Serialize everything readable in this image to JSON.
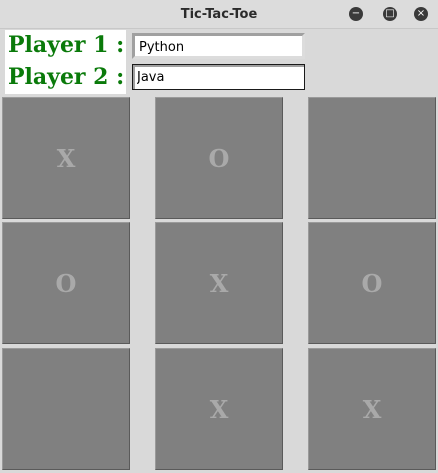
{
  "window": {
    "title": "Tic-Tac-Toe",
    "controls": {
      "minimize_glyph": "−",
      "maximize_glyph": "□",
      "close_glyph": "×"
    }
  },
  "players": {
    "player1_label": "Player 1 :",
    "player1_name": "Python",
    "player2_label": "Player 2 :",
    "player2_name": "Java"
  },
  "board": {
    "cells": [
      "X",
      "O",
      "",
      "O",
      "X",
      "O",
      "",
      "X",
      "X"
    ]
  },
  "colors": {
    "label_green": "#0a7a0a",
    "cell_bg": "#808080",
    "mark": "#a9a9a9",
    "background": "#d9d9d9"
  }
}
